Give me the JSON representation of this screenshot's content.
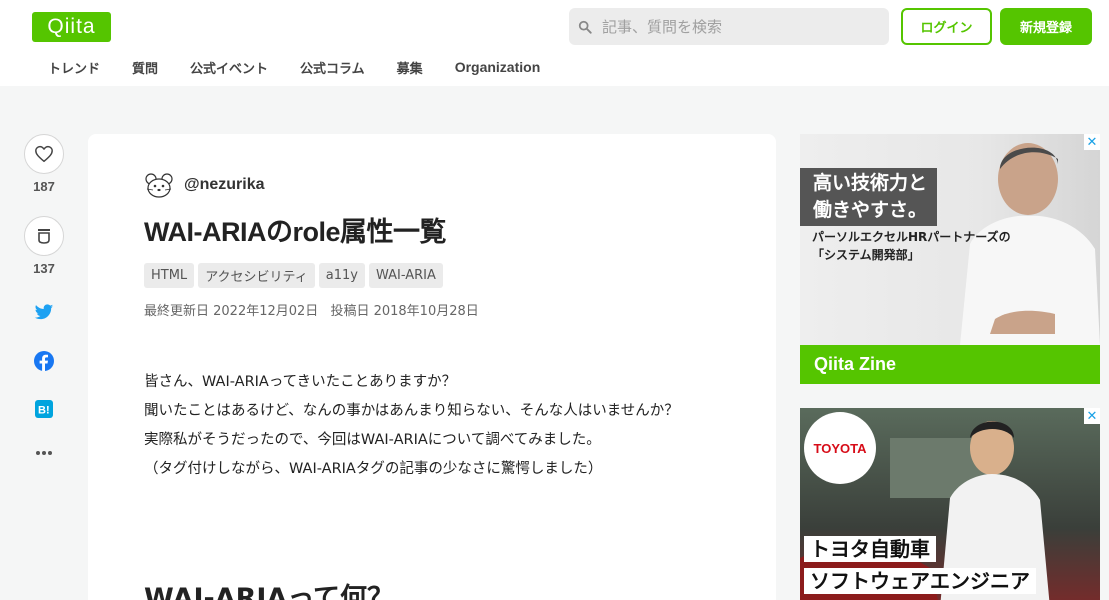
{
  "header": {
    "logo": "Qiita",
    "search_placeholder": "記事、質問を検索",
    "login_label": "ログイン",
    "signup_label": "新規登録"
  },
  "nav": {
    "items": [
      "トレンド",
      "質問",
      "公式イベント",
      "公式コラム",
      "募集",
      "Organization"
    ]
  },
  "actions": {
    "like_count": "187",
    "stock_count": "137",
    "share_icons": [
      "twitter-icon",
      "facebook-icon",
      "hatena-bookmark-icon",
      "more-icon"
    ]
  },
  "article": {
    "author": "@nezurika",
    "title": "WAI-ARIAのrole属性一覧",
    "tags": [
      "HTML",
      "アクセシビリティ",
      "a11y",
      "WAI-ARIA"
    ],
    "updated": "最終更新日 2022年12月02日",
    "posted": "投稿日 2018年10月28日",
    "paragraphs": [
      "皆さん、WAI-ARIAってきいたことありますか？",
      "聞いたことはあるけど、なんの事かはあんまり知らない、そんな人はいませんか？",
      "実際私がそうだったので、今回はWAI-ARIAについて調べてみました。",
      "（タグ付けしながら、WAI-ARIAタグの記事の少なさに驚愕しました）"
    ],
    "heading2": "WAI-ARIAって何？"
  },
  "ads": {
    "ad1": {
      "headline1": "高い技術力と",
      "headline2": "働きやすさ。",
      "sub1": "パーソルエクセルHRパートナーズの",
      "sub2": "「システム開発部」",
      "footer": "Qiita Zine"
    },
    "ad2": {
      "logo": "TOYOTA",
      "caption1": "トヨタ自動車",
      "caption2": "ソフトウェアエンジニア"
    }
  },
  "colors": {
    "brand": "#55c500",
    "twitter": "#1da1f2",
    "facebook": "#1877f2",
    "hatena": "#00a4de"
  }
}
